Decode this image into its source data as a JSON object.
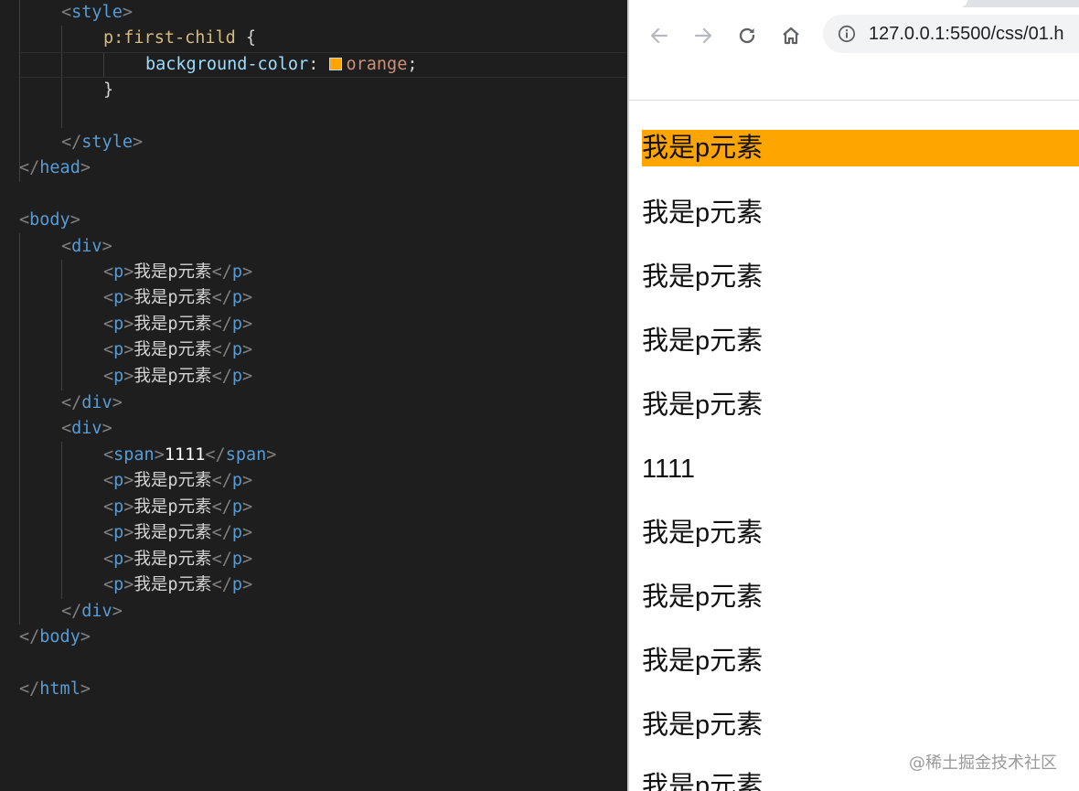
{
  "editor": {
    "lines": {
      "style_open": {
        "lt": "<",
        "tag": "style",
        "gt": ">"
      },
      "selector": {
        "sel": "p:first-child",
        "brace": " {"
      },
      "declaration": {
        "prop": "background-color",
        "colon": ": ",
        "value": "orange",
        "semi": ";"
      },
      "close_brace": "}",
      "style_close": {
        "lt": "</",
        "tag": "style",
        "gt": ">"
      },
      "head_close": {
        "lt": "</",
        "tag": "head",
        "gt": ">"
      },
      "body_open": {
        "lt": "<",
        "tag": "body",
        "gt": ">"
      },
      "div_open": {
        "lt": "<",
        "tag": "div",
        "gt": ">"
      },
      "div_close": {
        "lt": "</",
        "tag": "div",
        "gt": ">"
      },
      "p_tag": {
        "lt": "<",
        "tag": "p",
        "gt": ">",
        "text": "我是p元素",
        "clt": "</",
        "ctag": "p",
        "cgt": ">"
      },
      "span_line": {
        "lt": "<",
        "tag": "span",
        "gt": ">",
        "text": "1111",
        "clt": "</",
        "ctag": "span",
        "cgt": ">"
      },
      "body_close": {
        "lt": "</",
        "tag": "body",
        "gt": ">"
      },
      "html_close": {
        "lt": "</",
        "tag": "html",
        "gt": ">"
      }
    },
    "swatch_color": "#ffa500"
  },
  "browser": {
    "url": "127.0.0.1:5500/css/01.h",
    "icons": [
      "back-arrow-icon",
      "forward-arrow-icon",
      "reload-icon",
      "home-icon",
      "info-icon"
    ],
    "paragraphs": [
      "我是p元素",
      "我是p元素",
      "我是p元素",
      "我是p元素",
      "我是p元素",
      "1111",
      "我是p元素",
      "我是p元素",
      "我是p元素",
      "我是p元素",
      "我是p元素"
    ],
    "highlight_color": "#ffa500"
  },
  "watermark": "@稀土掘金技术社区"
}
